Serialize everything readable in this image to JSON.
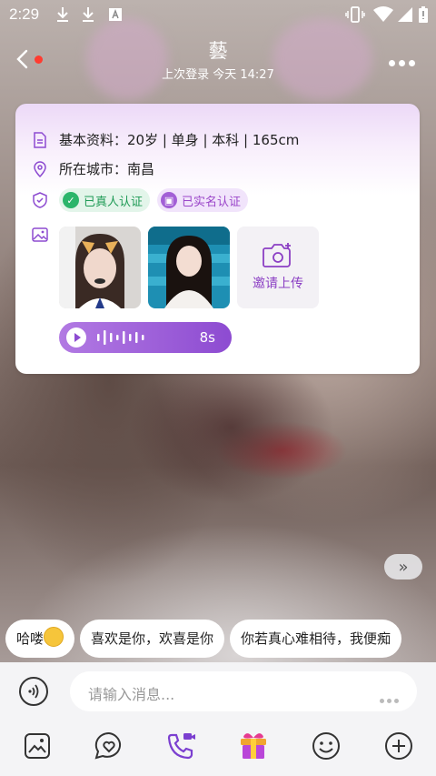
{
  "status_bar": {
    "time": "2:29"
  },
  "header": {
    "title": "藝",
    "last_login": "上次登录 今天 14:27"
  },
  "profile_card": {
    "basic_info": "基本资料：20岁 | 单身 | 本科 | 165cm",
    "city": "所在城市：南昌",
    "badges": [
      {
        "label": "已真人认证",
        "color": "#1e9a55"
      },
      {
        "label": "已实名认证",
        "color": "#9a45c9"
      }
    ],
    "invite_upload_label": "邀请上传",
    "voice_duration": "8s"
  },
  "quick_phrases": [
    {
      "text": "哈喽"
    },
    {
      "text": "喜欢是你，欢喜是你"
    },
    {
      "text": "你若真心难相待，我便痴"
    }
  ],
  "composer": {
    "placeholder": "请输入消息..."
  },
  "colors": {
    "accent": "#8d4bd1",
    "badge_green": "#1e9a55",
    "notification_dot": "#ff3b30"
  }
}
